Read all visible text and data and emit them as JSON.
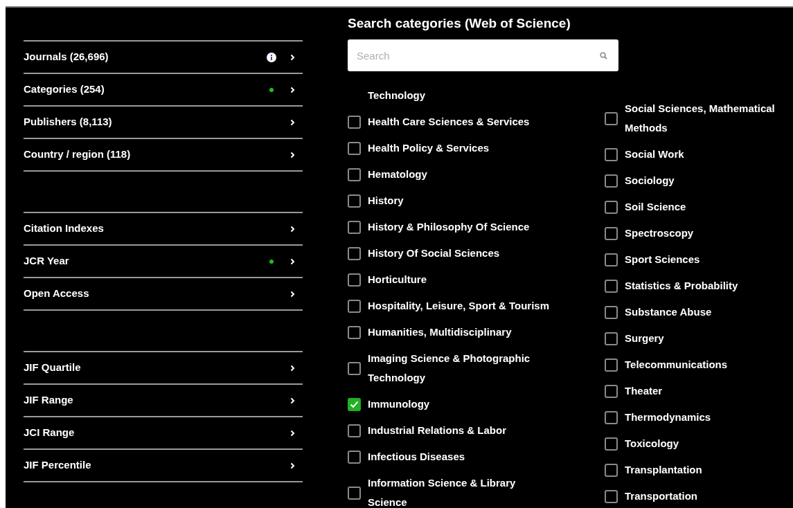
{
  "sidebar": {
    "groups": [
      {
        "items": [
          {
            "label": "Journals (26,696)",
            "info": true,
            "active": false
          },
          {
            "label": "Categories (254)",
            "info": false,
            "active": true
          },
          {
            "label": "Publishers (8,113)",
            "info": false,
            "active": false
          },
          {
            "label": "Country / region (118)",
            "info": false,
            "active": false
          }
        ]
      },
      {
        "items": [
          {
            "label": "Citation Indexes",
            "info": false,
            "active": false
          },
          {
            "label": "JCR Year",
            "info": false,
            "active": true
          },
          {
            "label": "Open Access",
            "info": false,
            "active": false
          }
        ]
      },
      {
        "items": [
          {
            "label": "JIF Quartile",
            "info": false,
            "active": false
          },
          {
            "label": "JIF Range",
            "info": false,
            "active": false
          },
          {
            "label": "JCI Range",
            "info": false,
            "active": false
          },
          {
            "label": "JIF Percentile",
            "info": false,
            "active": false
          }
        ]
      }
    ]
  },
  "panel": {
    "title": "Search categories (Web of Science)",
    "search": {
      "placeholder": "Search"
    },
    "columns": [
      [
        {
          "kind": "continuation",
          "label": "Technology"
        },
        {
          "kind": "checkbox",
          "label": "Health Care Sciences & Services",
          "checked": false
        },
        {
          "kind": "checkbox",
          "label": "Health Policy & Services",
          "checked": false
        },
        {
          "kind": "checkbox",
          "label": "Hematology",
          "checked": false
        },
        {
          "kind": "checkbox",
          "label": "History",
          "checked": false
        },
        {
          "kind": "checkbox",
          "label": "History & Philosophy Of Science",
          "checked": false
        },
        {
          "kind": "checkbox",
          "label": "History Of Social Sciences",
          "checked": false
        },
        {
          "kind": "checkbox",
          "label": "Horticulture",
          "checked": false
        },
        {
          "kind": "checkbox",
          "label": "Hospitality, Leisure, Sport & Tourism",
          "checked": false
        },
        {
          "kind": "checkbox",
          "label": "Humanities, Multidisciplinary",
          "checked": false
        },
        {
          "kind": "checkbox",
          "label": "Imaging Science & Photographic Technology",
          "checked": false
        },
        {
          "kind": "checkbox",
          "label": "Immunology",
          "checked": true
        },
        {
          "kind": "checkbox",
          "label": "Industrial Relations & Labor",
          "checked": false
        },
        {
          "kind": "checkbox",
          "label": "Infectious Diseases",
          "checked": false
        },
        {
          "kind": "checkbox",
          "label": "Information Science & Library Science",
          "checked": false
        }
      ],
      [
        {
          "kind": "checkbox",
          "label": "Social Sciences, Mathematical Methods",
          "checked": false
        },
        {
          "kind": "checkbox",
          "label": "Social Work",
          "checked": false
        },
        {
          "kind": "checkbox",
          "label": "Sociology",
          "checked": false
        },
        {
          "kind": "checkbox",
          "label": "Soil Science",
          "checked": false
        },
        {
          "kind": "checkbox",
          "label": "Spectroscopy",
          "checked": false
        },
        {
          "kind": "checkbox",
          "label": "Sport Sciences",
          "checked": false
        },
        {
          "kind": "checkbox",
          "label": "Statistics & Probability",
          "checked": false
        },
        {
          "kind": "checkbox",
          "label": "Substance Abuse",
          "checked": false
        },
        {
          "kind": "checkbox",
          "label": "Surgery",
          "checked": false
        },
        {
          "kind": "checkbox",
          "label": "Telecommunications",
          "checked": false
        },
        {
          "kind": "checkbox",
          "label": "Theater",
          "checked": false
        },
        {
          "kind": "checkbox",
          "label": "Thermodynamics",
          "checked": false
        },
        {
          "kind": "checkbox",
          "label": "Toxicology",
          "checked": false
        },
        {
          "kind": "checkbox",
          "label": "Transplantation",
          "checked": false
        },
        {
          "kind": "checkbox",
          "label": "Transportation",
          "checked": false
        }
      ]
    ]
  }
}
